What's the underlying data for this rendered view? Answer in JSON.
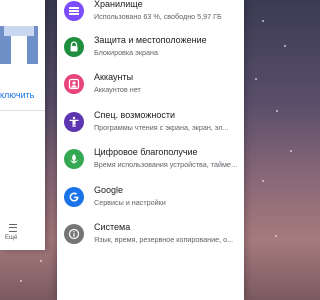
{
  "background_card": {
    "link_text": "ключить",
    "footer_label": "Ещё"
  },
  "settings": {
    "items": [
      {
        "title": "Хранилище",
        "subtitle": "Использовано 63 %, свободно 5,97 ГБ",
        "icon": "storage-icon",
        "color": "#7c4dff"
      },
      {
        "title": "Защита и местоположение",
        "subtitle": "Блокировка экрана",
        "icon": "lock-icon",
        "color": "#1e8e3e"
      },
      {
        "title": "Аккаунты",
        "subtitle": "Аккаунтов нет",
        "icon": "accounts-icon",
        "color": "#e8457a"
      },
      {
        "title": "Спец. возможности",
        "subtitle": "Программы чтения с экрана, экран, эл...",
        "icon": "accessibility-icon",
        "color": "#5e35b1"
      },
      {
        "title": "Цифровое благополучие",
        "subtitle": "Время использования устройства, таймеры...",
        "icon": "wellbeing-icon",
        "color": "#34a853"
      },
      {
        "title": "Google",
        "subtitle": "Сервисы и настройки",
        "icon": "google-icon",
        "color": "#1a73e8"
      },
      {
        "title": "Система",
        "subtitle": "Язык, время, резервное копирование, о...",
        "icon": "system-icon",
        "color": "#757575"
      }
    ]
  }
}
